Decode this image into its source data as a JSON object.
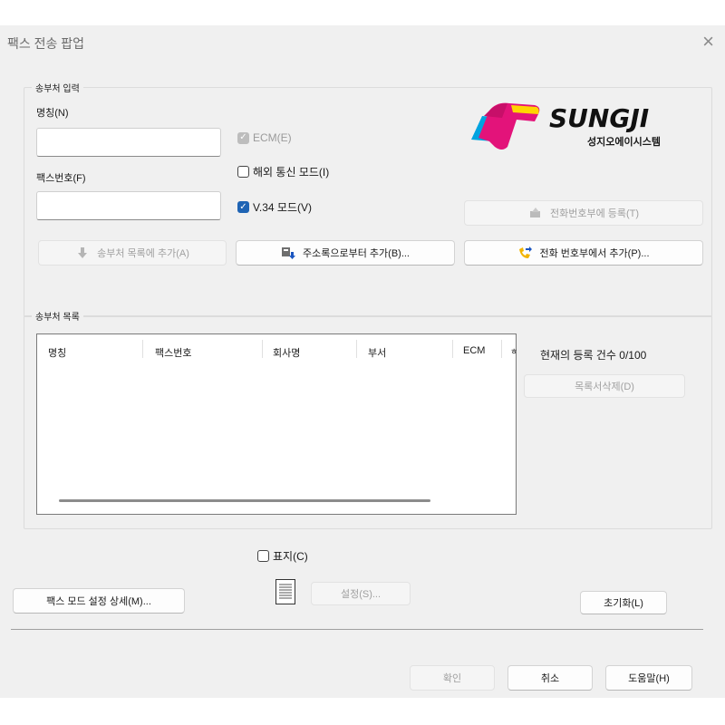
{
  "window": {
    "title": "팩스 전송 팝업",
    "close_icon": "×"
  },
  "recipient_input": {
    "legend": "송부처 입력",
    "name_label": "명칭(N)",
    "name_value": "",
    "fax_label": "팩스번호(F)",
    "fax_value": "",
    "ecm_label": "ECM(E)",
    "overseas_label": "해외 통신 모드(I)",
    "v34_label": "V.34 모드(V)",
    "register_phonebook_label": "전화번호부에 등록(T)",
    "add_to_list_label": "송부처 목록에 추가(A)",
    "from_addressbook_label": "주소록으로부터 추가(B)...",
    "from_phonebook_label": "전화 번호부에서 추가(P)..."
  },
  "logo": {
    "brand": "SUNGJI",
    "subtitle": "성지오에이시스템",
    "colors": [
      "#e3137a",
      "#ffd400",
      "#00a3e0",
      "#111111"
    ]
  },
  "recipient_list": {
    "legend": "송부처 목록",
    "columns": [
      "명칭",
      "팩스번호",
      "회사명",
      "부서",
      "ECM",
      "ㅎ"
    ],
    "rows": [],
    "count_text": "현재의 등록 건수 0/100",
    "delete_label": "목록서삭제(D)"
  },
  "cover": {
    "label": "표지(C)",
    "settings_label": "설정(S)..."
  },
  "buttons": {
    "fax_mode_detail": "팩스 모드 설정 상세(M)...",
    "reset": "초기화(L)",
    "ok": "확인",
    "cancel": "취소",
    "help": "도움말(H)"
  },
  "state": {
    "ecm_checked": true,
    "ecm_disabled": true,
    "overseas_checked": false,
    "v34_checked": true,
    "cover_checked": false
  }
}
